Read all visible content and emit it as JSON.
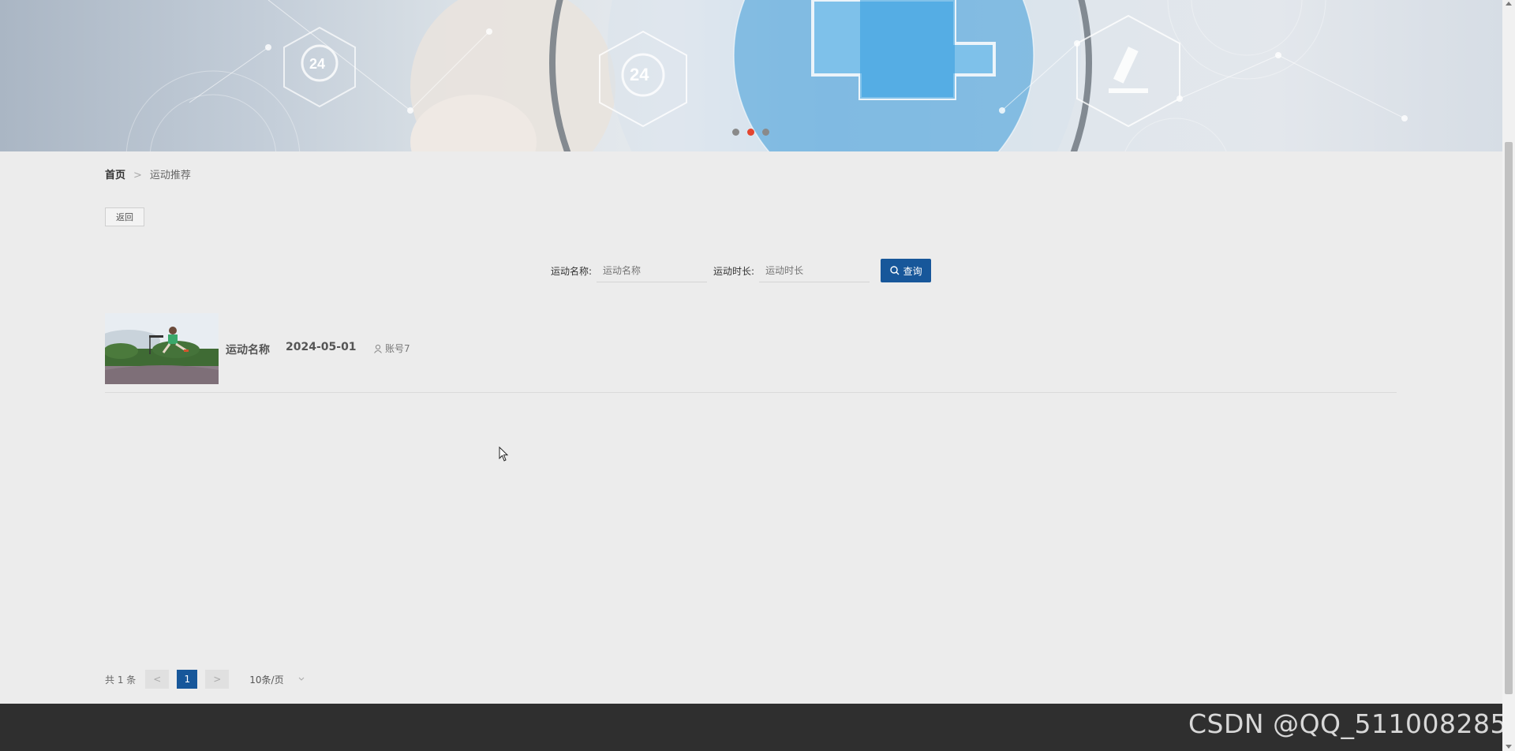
{
  "banner": {
    "slide_count": 3,
    "active_slide": 2
  },
  "breadcrumb": {
    "home": "首页",
    "separator": ">",
    "current": "运动推荐"
  },
  "back_label": "返回",
  "search": {
    "name_label": "运动名称:",
    "name_placeholder": "运动名称",
    "duration_label": "运动时长:",
    "duration_placeholder": "运动时长",
    "query_label": "查询"
  },
  "items": [
    {
      "title": "运动名称",
      "date": "2024-05-01",
      "account": "账号7"
    }
  ],
  "pagination": {
    "total": "共 1 条",
    "prev": "<",
    "current": "1",
    "next": ">",
    "page_size": "10条/页"
  },
  "watermark": "CSDN @QQ_511008285",
  "colors": {
    "primary": "#17579a",
    "footer": "#2f2f2f",
    "active_dot": "#e4452f"
  }
}
